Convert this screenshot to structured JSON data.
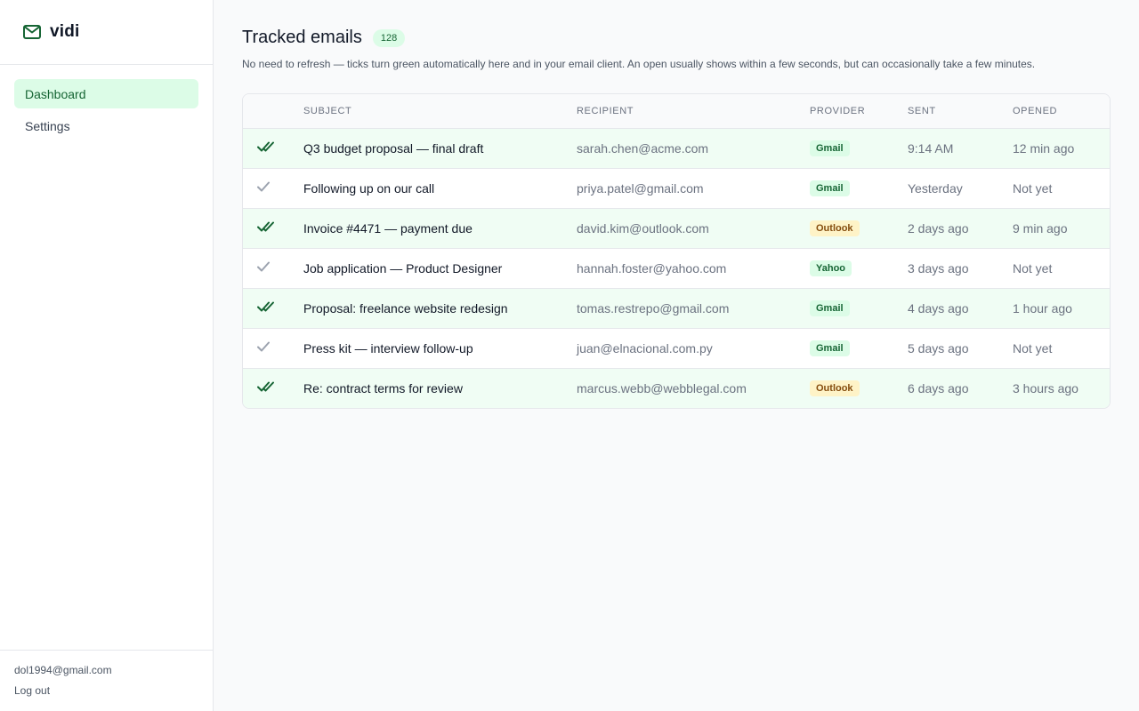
{
  "app": {
    "name": "vidi"
  },
  "sidebar": {
    "items": [
      {
        "label": "Dashboard",
        "active": true
      },
      {
        "label": "Settings",
        "active": false
      }
    ],
    "user_email": "dol1994@gmail.com",
    "logout_label": "Log out"
  },
  "main": {
    "title": "Tracked emails",
    "count": "128",
    "subtitle": "No need to refresh — ticks turn green automatically here and in your email client. An open usually shows within a few seconds, but can occasionally take a few minutes.",
    "columns": [
      "SUBJECT",
      "RECIPIENT",
      "PROVIDER",
      "SENT",
      "OPENED"
    ],
    "rows": [
      {
        "status": "opened",
        "subject": "Q3 budget proposal — final draft",
        "recipient": "sarah.chen@acme.com",
        "provider": "Gmail",
        "sent": "9:14 AM",
        "opened": "12 min ago"
      },
      {
        "status": "sent",
        "subject": "Following up on our call",
        "recipient": "priya.patel@gmail.com",
        "provider": "Gmail",
        "sent": "Yesterday",
        "opened": "Not yet"
      },
      {
        "status": "opened",
        "subject": "Invoice #4471 — payment due",
        "recipient": "david.kim@outlook.com",
        "provider": "Outlook",
        "sent": "2 days ago",
        "opened": "9 min ago"
      },
      {
        "status": "sent",
        "subject": "Job application — Product Designer",
        "recipient": "hannah.foster@yahoo.com",
        "provider": "Yahoo",
        "sent": "3 days ago",
        "opened": "Not yet"
      },
      {
        "status": "opened",
        "subject": "Proposal: freelance website redesign",
        "recipient": "tomas.restrepo@gmail.com",
        "provider": "Gmail",
        "sent": "4 days ago",
        "opened": "1 hour ago"
      },
      {
        "status": "sent",
        "subject": "Press kit — interview follow-up",
        "recipient": "juan@elnacional.com.py",
        "provider": "Gmail",
        "sent": "5 days ago",
        "opened": "Not yet"
      },
      {
        "status": "opened",
        "subject": "Re: contract terms for review",
        "recipient": "marcus.webb@webblegal.com",
        "provider": "Outlook",
        "sent": "6 days ago",
        "opened": "3 hours ago"
      }
    ]
  },
  "icons": {
    "brand": "mail-icon",
    "opened_tick": "double-check-icon",
    "sent_tick": "check-icon"
  },
  "colors": {
    "accent": "#166534",
    "accent_bg": "#dcfce7",
    "opened_row_bg": "#f0fdf4",
    "outlook_bg": "#fef3c7",
    "single_tick": "#9ca3af"
  }
}
